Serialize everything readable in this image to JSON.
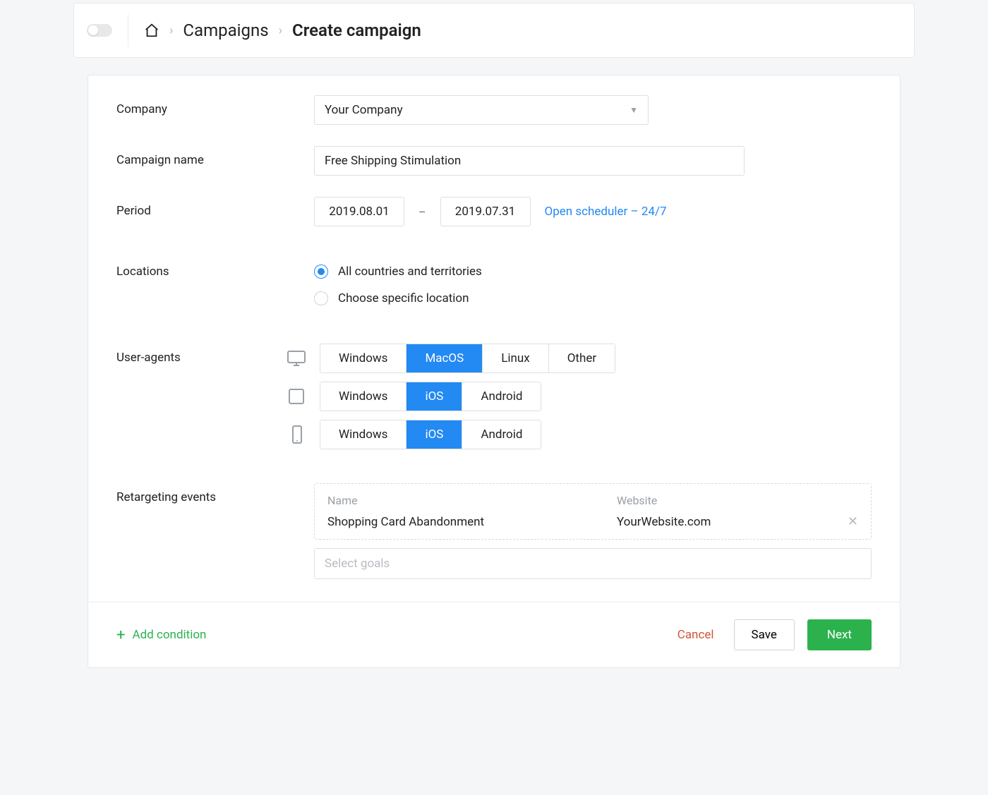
{
  "breadcrumb": {
    "campaigns": "Campaigns",
    "create": "Create campaign"
  },
  "labels": {
    "company": "Company",
    "campaign_name": "Campaign name",
    "period": "Period",
    "locations": "Locations",
    "user_agents": "User-agents",
    "retargeting": "Retargeting events"
  },
  "company": {
    "selected": "Your Company"
  },
  "campaign_name": {
    "value": "Free Shipping Stimulation"
  },
  "period": {
    "start": "2019.08.01",
    "end": "2019.07.31",
    "dash": "–",
    "scheduler_link": "Open scheduler – 24/7"
  },
  "locations": {
    "option_all": "All countries and territories",
    "option_specific": "Choose specific location"
  },
  "ua": {
    "desktop": [
      "Windows",
      "MacOS",
      "Linux",
      "Other"
    ],
    "desktop_active": "MacOS",
    "tablet": [
      "Windows",
      "iOS",
      "Android"
    ],
    "tablet_active": "iOS",
    "mobile": [
      "Windows",
      "iOS",
      "Android"
    ],
    "mobile_active": "iOS"
  },
  "retargeting": {
    "header_name": "Name",
    "header_site": "Website",
    "event_name": "Shopping Card Abandonment",
    "event_site": "YourWebsite.com",
    "goals_placeholder": "Select goals"
  },
  "footer": {
    "add_condition": "Add condition",
    "cancel": "Cancel",
    "save": "Save",
    "next": "Next"
  }
}
